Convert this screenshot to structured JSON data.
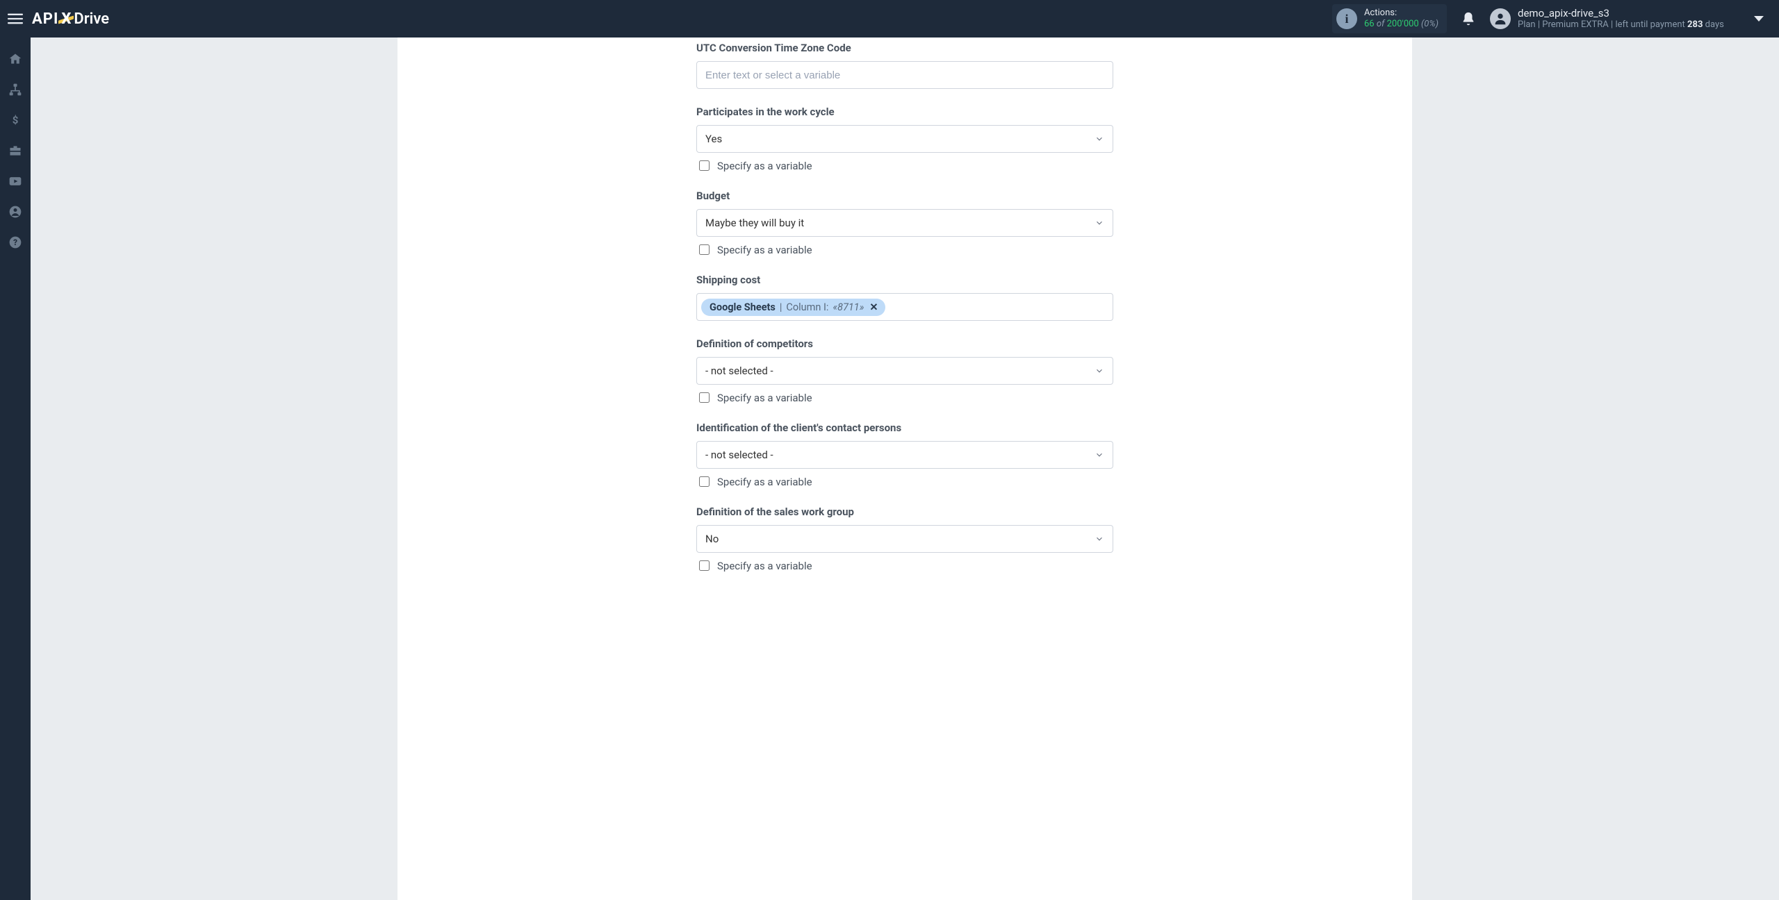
{
  "header": {
    "logo": {
      "left": "API",
      "mid": "X",
      "right": "Drive"
    },
    "actions": {
      "label": "Actions:",
      "count": "66",
      "of": "of",
      "max": "200'000",
      "pct": "(0%)"
    },
    "user": {
      "name": "demo_apix-drive_s3",
      "plan_prefix": "Plan |",
      "plan_name": "Premium EXTRA",
      "plan_sep": "|",
      "left_until": "left until payment",
      "days_num": "283",
      "days_word": "days"
    }
  },
  "form": {
    "utc": {
      "label": "UTC Conversion Time Zone Code",
      "placeholder": "Enter text or select a variable"
    },
    "participates": {
      "label": "Participates in the work cycle",
      "value": "Yes",
      "specify": "Specify as a variable"
    },
    "budget": {
      "label": "Budget",
      "value": "Maybe they will buy it",
      "specify": "Specify as a variable"
    },
    "shipping": {
      "label": "Shipping cost",
      "chip": {
        "source": "Google Sheets",
        "separator": " | ",
        "column_label": "Column I:",
        "value": "«8711»"
      }
    },
    "competitors": {
      "label": "Definition of competitors",
      "value": "- not selected -",
      "specify": "Specify as a variable"
    },
    "contacts": {
      "label": "Identification of the client's contact persons",
      "value": "- not selected -",
      "specify": "Specify as a variable"
    },
    "sales_group": {
      "label": "Definition of the sales work group",
      "value": "No",
      "specify": "Specify as a variable"
    }
  }
}
